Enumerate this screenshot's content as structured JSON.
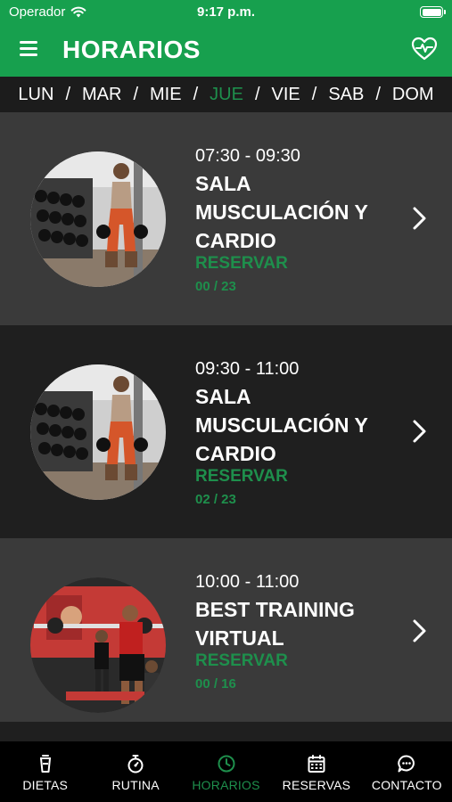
{
  "status": {
    "carrier": "Operador",
    "time": "9:17 p.m."
  },
  "header": {
    "title": "HORARIOS",
    "menu_icon": "hamburger-icon",
    "action_icon": "heart-pulse-icon"
  },
  "days": [
    {
      "label": "LUN",
      "active": false
    },
    {
      "label": "MAR",
      "active": false
    },
    {
      "label": "MIE",
      "active": false
    },
    {
      "label": "JUE",
      "active": true
    },
    {
      "label": "VIE",
      "active": false
    },
    {
      "label": "SAB",
      "active": false
    },
    {
      "label": "DOM",
      "active": false
    }
  ],
  "classes": [
    {
      "time": "07:30 - 09:30",
      "title": "SALA MUSCULACIÓN Y CARDIO",
      "action": "RESERVAR",
      "spots": "00 / 23",
      "image": "gym-woman-dumbbells"
    },
    {
      "time": "09:30 - 11:00",
      "title": "SALA MUSCULACIÓN Y CARDIO",
      "action": "RESERVAR",
      "spots": "02 / 23",
      "image": "gym-woman-dumbbells"
    },
    {
      "time": "10:00 - 11:00",
      "title": "BEST TRAINING VIRTUAL",
      "action": "RESERVAR",
      "spots": "00 / 16",
      "image": "group-barbell-class"
    }
  ],
  "tabs": [
    {
      "label": "DIETAS",
      "icon": "cup-icon",
      "active": false
    },
    {
      "label": "RUTINA",
      "icon": "stopwatch-icon",
      "active": false
    },
    {
      "label": "HORARIOS",
      "icon": "clock-icon",
      "active": true
    },
    {
      "label": "RESERVAS",
      "icon": "calendar-icon",
      "active": false
    },
    {
      "label": "CONTACTO",
      "icon": "chat-icon",
      "active": false
    }
  ],
  "colors": {
    "brand_green": "#17a04e",
    "accent_green": "#1e8f4c",
    "tab_bar": "#000000"
  }
}
